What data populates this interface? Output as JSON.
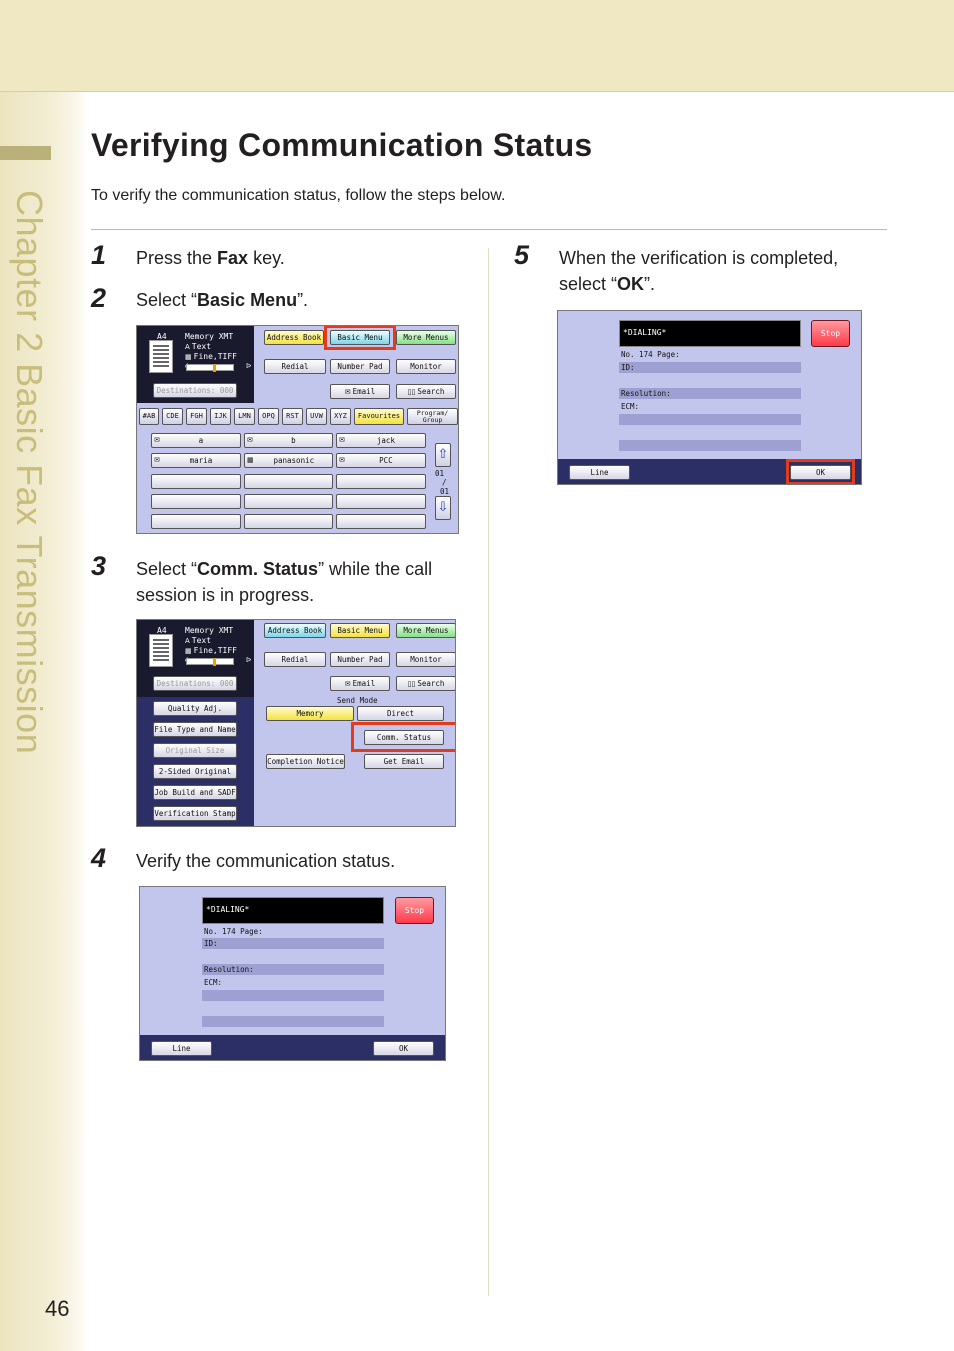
{
  "chapter": {
    "label": "Chapter 2   Basic Fax Transmission"
  },
  "page": {
    "title": "Verifying Communication Status",
    "intro": "To verify the communication status, follow the steps below.",
    "number": "46"
  },
  "steps": [
    {
      "num": "1",
      "pre": "Press the ",
      "bold": "Fax",
      "post": " key."
    },
    {
      "num": "2",
      "pre": "Select “",
      "bold": "Basic Menu",
      "post": "”."
    },
    {
      "num": "3",
      "pre": "Select “",
      "bold": "Comm. Status",
      "post": "” while the call session is in progress."
    },
    {
      "num": "4",
      "pre": "Verify the communication status.",
      "bold": "",
      "post": ""
    },
    {
      "num": "5",
      "pre": "When the verification is completed, select “",
      "bold": "OK",
      "post": "”."
    }
  ],
  "screen_common": {
    "paper": "A4",
    "mode": "Memory XMT",
    "orig_type": "Text",
    "resolution": "Fine,TIFF",
    "destinations": "Destinations: 000",
    "address_book": "Address Book",
    "basic_menu": "Basic Menu",
    "more_menus": "More Menus",
    "redial": "Redial",
    "number_pad": "Number Pad",
    "monitor": "Monitor",
    "email": "Email",
    "search": "Search",
    "ab_icon": "A",
    "tray_icon": "▦",
    "spk_left": "◖",
    "spk_right": "ᐅ",
    "mail_icon": "✉",
    "book_icon": "▯▯"
  },
  "screen1": {
    "tabs": [
      "#AB",
      "CDE",
      "FGH",
      "IJK",
      "LMN",
      "OPQ",
      "RST",
      "UVW",
      "XYZ",
      "Favourites",
      "Program/ Group"
    ],
    "entries": [
      "a",
      "b",
      "jack",
      "maria",
      "panasonic",
      "PCC"
    ],
    "page_current": "01",
    "page_sep": "/",
    "page_total": "01",
    "up_icon": "⇧",
    "down_icon": "⇩"
  },
  "screen2": {
    "left_menu": [
      "Quality Adj.",
      "File Type and Name",
      "Original Size",
      "2-Sided Original",
      "Job Build and SADF",
      "Verification Stamp"
    ],
    "send_mode_label": "Send Mode",
    "memory": "Memory",
    "direct": "Direct",
    "comm_status": "Comm. Status",
    "completion_notice": "Completion Notice",
    "get_email": "Get Email"
  },
  "status_screen": {
    "dialing": "*DIALING*",
    "stop": "Stop",
    "no_label": "No. 174   Page:",
    "id_label": "ID:",
    "resolution_label": "Resolution:",
    "ecm_label": "ECM:",
    "line": "Line",
    "ok": "OK"
  },
  "colors": {
    "accent_band": "#efe8c3",
    "chapter_text": "#c8bd7a",
    "highlight": "#e33b1e",
    "screen_bg": "#c3c6ec"
  }
}
